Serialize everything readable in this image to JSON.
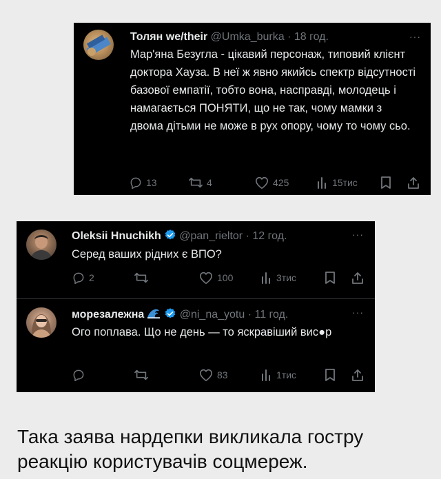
{
  "tweets": [
    {
      "name": "Толян we/their",
      "handle": "@Umka_burka",
      "time": "· 18 год.",
      "more": "···",
      "text": "Мар'яна Безугла - цікавий персонаж, типовий клієнт доктора Хауза. В неї ж явно якийсь спектр відсутності базової емпатії, тобто вона, насправді, молодець і намагається ПОНЯТИ, що не так, чому мамки з двома дітьми не може в рух опору, чому то чому сьо.",
      "replies": "13",
      "reposts": "4",
      "likes": "425",
      "views": "15тис"
    },
    {
      "name": "Oleksii Hnuchikh",
      "handle": "@pan_rieltor",
      "time": "· 12 год.",
      "more": "···",
      "text": "Серед ваших рідних є ВПО?",
      "replies": "2",
      "reposts": "",
      "likes": "100",
      "views": "3тис"
    },
    {
      "name": "морезалежна",
      "handle": "@ni_na_yotu",
      "time": "· 11 год.",
      "more": "···",
      "text": "Ого поплава. Що не день — то яскравіший вис●р",
      "replies": "",
      "reposts": "",
      "likes": "83",
      "views": "1тис"
    }
  ],
  "caption": "Така заява нардепки викликала гостру реакцію користувачів соцмереж.",
  "colors": {
    "tweet_bg": "#000000",
    "text": "#e7e9ea",
    "muted": "#71767b",
    "verified": "#1d9bf0",
    "page_bg": "#ececec"
  }
}
